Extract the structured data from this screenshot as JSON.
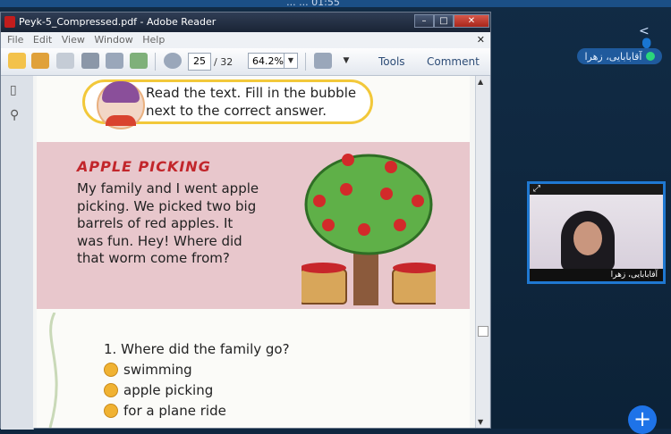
{
  "desktop": {
    "top_title": "... ... 01:55",
    "participant_chip": "آقابابایی، زهرا",
    "video_name": "آقابابایی، زهرا"
  },
  "window": {
    "title": "Peyk-5_Compressed.pdf - Adobe Reader",
    "menu": [
      "File",
      "Edit",
      "View",
      "Window",
      "Help"
    ],
    "page_current": "25",
    "page_total": "/ 32",
    "zoom": "64.2%",
    "tools_label": "Tools",
    "comment_label": "Comment"
  },
  "page": {
    "instruction": "Read the text. Fill in the bubble next to the correct answer.",
    "story_title": "APPLE PICKING",
    "story_text": "My family and I went apple picking. We picked two big barrels of red apples. It was fun. Hey! Where did that worm come from?",
    "question": "1. Where did the family go?",
    "options": [
      "swimming",
      "apple picking",
      "for a plane ride"
    ]
  },
  "colors": {
    "story_bg": "#e8c7cc",
    "bubble": "#f0b232",
    "title_red": "#c2262b",
    "accent_blue": "#1e73e8"
  }
}
